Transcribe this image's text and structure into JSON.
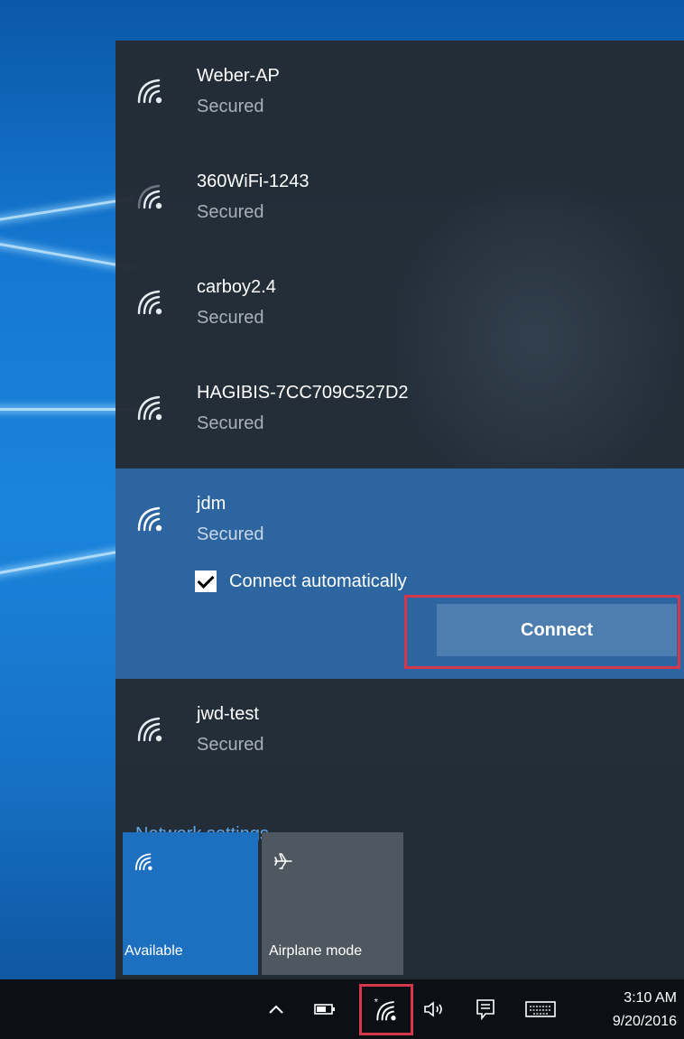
{
  "networks": [
    {
      "name": "Weber-AP",
      "status": "Secured"
    },
    {
      "name": "360WiFi-1243",
      "status": "Secured"
    },
    {
      "name": "carboy2.4",
      "status": "Secured"
    },
    {
      "name": "HAGIBIS-7CC709C527D2",
      "status": "Secured"
    },
    {
      "name": "jdm",
      "status": "Secured",
      "connect_automatically_label": "Connect automatically",
      "connect_automatically_checked": true,
      "connect_label": "Connect"
    },
    {
      "name": "jwd-test",
      "status": "Secured"
    }
  ],
  "network_settings_label": "Network settings",
  "quick_actions": [
    {
      "label": "Available",
      "icon": "wifi-icon"
    },
    {
      "label": "Airplane mode",
      "icon": "airplane-icon"
    }
  ],
  "taskbar": {
    "icons": [
      "chevron-up-icon",
      "battery-icon",
      "wifi-icon",
      "volume-icon",
      "action-center-icon",
      "keyboard-icon"
    ],
    "time": "3:10 AM",
    "date": "9/20/2016"
  },
  "colors": {
    "accent": "#1d6fbf",
    "selected_row": "#2c65a0",
    "highlight_border": "#d6364a",
    "flyout_bg": "#242b34",
    "link": "#5ea6e6"
  }
}
